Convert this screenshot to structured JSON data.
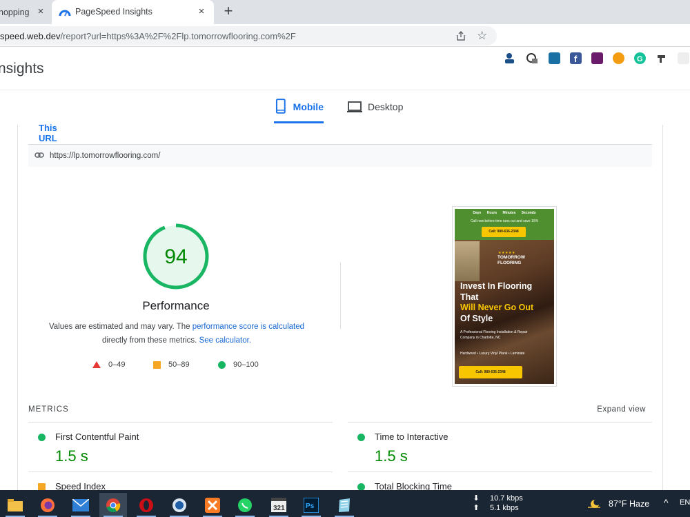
{
  "browser": {
    "tabs": [
      {
        "label": "hopping"
      },
      {
        "label": "PageSpeed Insights"
      }
    ],
    "url_host": "speed.web.dev",
    "url_rest": "/report?url=https%3A%2F%2Flp.tomorrowflooring.com%2F"
  },
  "site": {
    "title": "nsights"
  },
  "device_tabs": {
    "mobile": "Mobile",
    "desktop": "Desktop"
  },
  "report": {
    "this_url_tab": "This URL",
    "tested_url": "https://lp.tomorrowflooring.com/",
    "score": "94",
    "score_fraction": 0.94,
    "category": "Performance",
    "disclaimer_1": "Values are estimated and may vary. The ",
    "disclaimer_link_1": "performance score is calculated",
    "disclaimer_2": "directly from these metrics. ",
    "disclaimer_link_2": "See calculator.",
    "legend": [
      {
        "range": "0–49",
        "color": "#e53935",
        "icon": "triangle"
      },
      {
        "range": "50–89",
        "color": "#f5a623",
        "icon": "square"
      },
      {
        "range": "90–100",
        "color": "#18b662",
        "icon": "circle"
      }
    ],
    "colors": {
      "pass": "#18b662",
      "pass_text": "#008800",
      "accent": "#1a73e8"
    }
  },
  "thumbnail": {
    "countdown": "Days Hours Minutes Seconds",
    "offer": "Call now before time runs out and save 15%",
    "cta_top": "Call: 980-636-2348",
    "stars": "★★★★★",
    "logo_line1": "TOMORROW",
    "logo_line2": "FLOORING",
    "headline_1": "Invest In Flooring",
    "headline_2": "That",
    "headline_highlight": "Will Never Go Out",
    "headline_3": "Of Style",
    "subtext": "A Professional Flooring Installation & Repair Company in Charlotte, NC",
    "services": "Hardwood • Luxury Vinyl Plank • Laminate",
    "cta_bottom": "Call: 980-636-2348"
  },
  "metrics": {
    "heading": "METRICS",
    "expand": "Expand view",
    "items": [
      {
        "label": "First Contentful Paint",
        "value": "1.5 s",
        "status": "pass"
      },
      {
        "label": "Time to Interactive",
        "value": "1.5 s",
        "status": "pass"
      },
      {
        "label": "Speed Index",
        "value": "",
        "status": "average"
      },
      {
        "label": "Total Blocking Time",
        "value": "",
        "status": "pass"
      }
    ]
  },
  "taskbar": {
    "apps": [
      "file-explorer-icon",
      "firefox-icon",
      "mail-icon",
      "chrome-icon",
      "opera-icon",
      "ie-icon",
      "xampp-icon",
      "whatsapp-icon",
      "video-editor-icon",
      "photoshop-icon",
      "notepad-icon"
    ],
    "download_speed": "10.7 kbps",
    "upload_speed": "5.1 kbps",
    "weather": "87°F  Haze",
    "ime": "ENG"
  }
}
